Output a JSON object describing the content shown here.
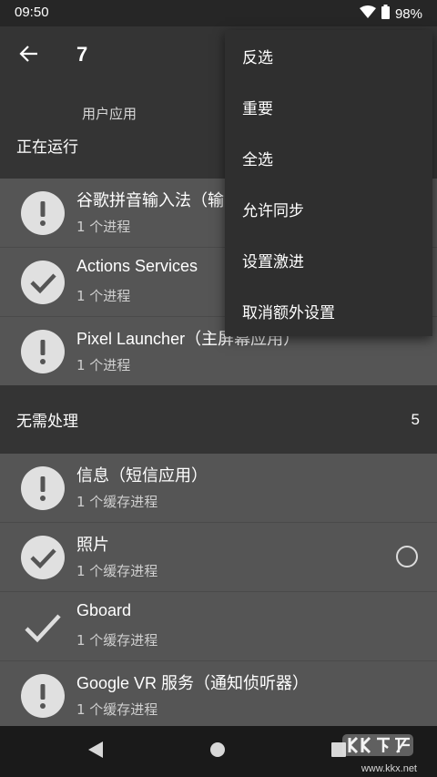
{
  "status_bar": {
    "time": "09:50",
    "battery": "98%",
    "icons": [
      "wifi-icon",
      "battery-icon"
    ]
  },
  "app_bar": {
    "title": "7",
    "back_icon": "arrow-left-icon"
  },
  "tabs": [
    {
      "label": "用户应用"
    }
  ],
  "sections": [
    {
      "title": "正在运行",
      "items": [
        {
          "name": "谷歌拼音输入法（输",
          "detail": "1 个进程",
          "icon": "alert-icon"
        },
        {
          "name": "Actions Services",
          "detail": "1 个进程",
          "icon": "check-circle-icon"
        },
        {
          "name": "Pixel Launcher（主屏幕应用）",
          "detail": "1 个进程",
          "icon": "alert-icon"
        }
      ]
    },
    {
      "title": "无需处理",
      "count": "5",
      "items": [
        {
          "name": "信息（短信应用）",
          "detail": "1 个缓存进程",
          "icon": "alert-icon"
        },
        {
          "name": "照片",
          "detail": "1 个缓存进程",
          "icon": "check-circle-icon",
          "radio": true
        },
        {
          "name": "Gboard",
          "detail": "1 个缓存进程",
          "icon": "check-icon"
        },
        {
          "name": "Google VR 服务（通知侦听器）",
          "detail": "1 个缓存进程",
          "icon": "alert-icon"
        }
      ]
    }
  ],
  "menu": {
    "items": [
      {
        "label": "反选"
      },
      {
        "label": "重要"
      },
      {
        "label": "全选"
      },
      {
        "label": "允许同步"
      },
      {
        "label": "设置激进"
      },
      {
        "label": "取消额外设置"
      }
    ]
  },
  "nav_bar": {
    "buttons": [
      "back-triangle-icon",
      "home-circle-icon",
      "recents-square-icon"
    ]
  },
  "watermark": {
    "text": "www.kkx.net",
    "logo_text": "KK下载"
  },
  "colors": {
    "accent": "#3d8ee6",
    "list_bg": "#555555",
    "header_bg": "#343434",
    "menu_bg": "#2f2f2f"
  }
}
